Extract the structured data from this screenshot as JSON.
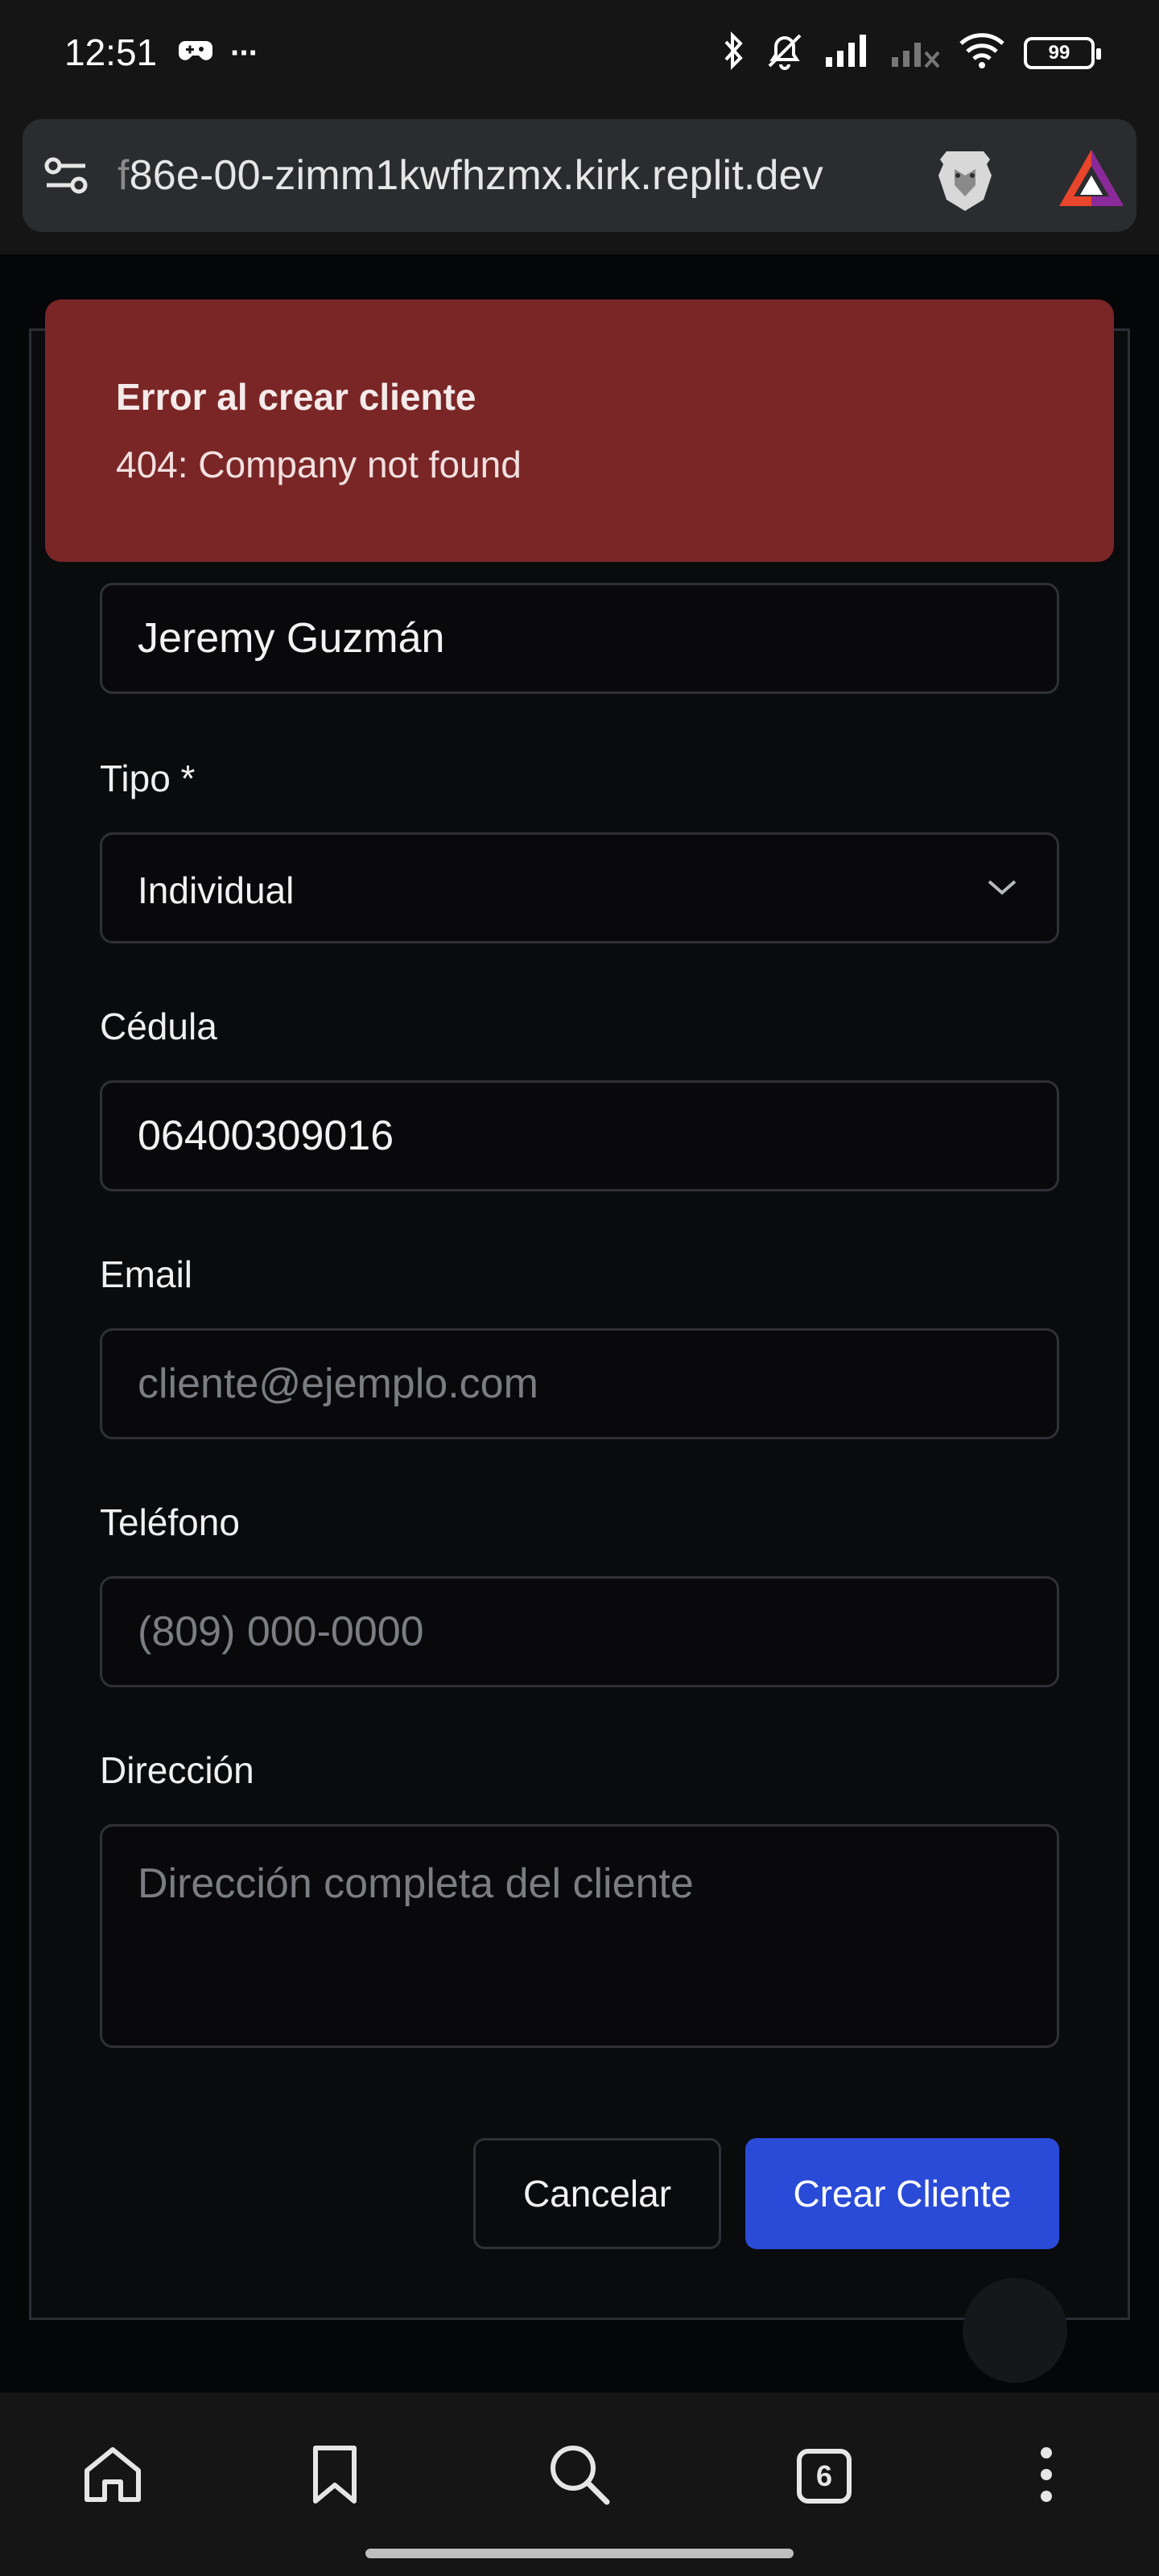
{
  "status_bar": {
    "time": "12:51",
    "overflow_dots": "···",
    "battery": "99"
  },
  "browser": {
    "url_faded": "f",
    "url": "86e-00-zimm1kwfhzmx.kirk.replit.dev"
  },
  "toast": {
    "title": "Error al crear cliente",
    "description": "404: Company not found"
  },
  "form": {
    "name": {
      "value": "Jeremy Guzmán"
    },
    "tipo": {
      "label": "Tipo *",
      "value": "Individual"
    },
    "cedula": {
      "label": "Cédula",
      "value": "06400309016"
    },
    "email": {
      "label": "Email",
      "placeholder": "cliente@ejemplo.com"
    },
    "telefono": {
      "label": "Teléfono",
      "placeholder": "(809) 000-0000"
    },
    "direccion": {
      "label": "Dirección",
      "placeholder": "Dirección completa del cliente"
    }
  },
  "actions": {
    "cancel_label": "Cancelar",
    "create_label": "Crear Cliente"
  },
  "bottom_nav": {
    "tabs_count": "6"
  },
  "colors": {
    "toast_bg": "#7a2626",
    "primary_button": "#2a4bd8",
    "background": "#0a0b0d"
  }
}
